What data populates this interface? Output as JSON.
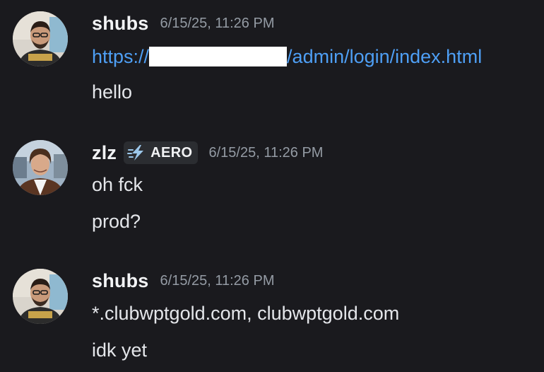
{
  "messages": [
    {
      "username": "shubs",
      "timestamp": "6/15/25, 11:26 PM",
      "link": {
        "prefix": "https://",
        "suffix": "/admin/login/index.html"
      },
      "lines": [
        "hello"
      ]
    },
    {
      "username": "zlz",
      "tag": "AERO",
      "timestamp": "6/15/25, 11:26 PM",
      "lines": [
        "oh fck",
        "prod?"
      ]
    },
    {
      "username": "shubs",
      "timestamp": "6/15/25, 11:26 PM",
      "lines": [
        "*.clubwptgold.com, clubwptgold.com",
        "idk yet"
      ]
    }
  ],
  "colors": {
    "background": "#1a1a1e",
    "link": "#4e9ff5",
    "username": "#f2f3f5",
    "timestamp": "#949ba4",
    "tag_bg": "#2b2d31"
  },
  "icons": {
    "tag_icon": "lightning-bolt-icon"
  }
}
